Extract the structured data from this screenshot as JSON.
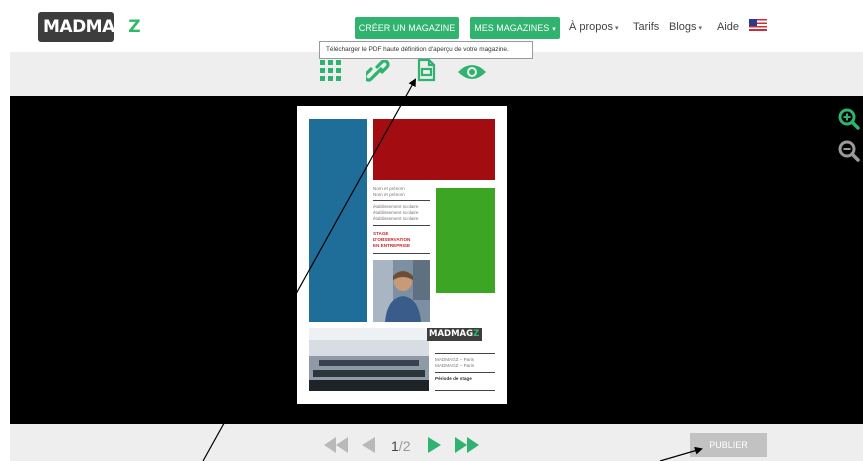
{
  "header": {
    "logo": {
      "main": "MADMAG",
      "accent": "Z"
    },
    "create_label": "CRÉER UN MAGAZINE",
    "my_mags_label": "MES MAGAZINES",
    "links": [
      {
        "label": "À propos",
        "dropdown": true
      },
      {
        "label": "Tarifs",
        "dropdown": false
      },
      {
        "label": "Blogs",
        "dropdown": true
      },
      {
        "label": "Aide",
        "dropdown": false
      }
    ],
    "language_icon": "us-flag-icon",
    "caret": "▾"
  },
  "toolbar": {
    "tools": [
      "grid-icon",
      "link-icon",
      "pdf-download-icon",
      "preview-eye-icon"
    ],
    "tooltip": "Télécharger le PDF haute définition d'aperçu de votre magazine."
  },
  "zoom": {
    "in_icon": "zoom-in-icon",
    "out_icon": "zoom-out-icon"
  },
  "preview": {
    "names": [
      "Nom et prénom",
      "Nom et prénom"
    ],
    "schools": [
      "établissement scolaire",
      "établissement scolaire",
      "établissement scolaire"
    ],
    "title_lines": [
      "STAGE",
      "D'OBSERVATION",
      "EN ENTREPRISE"
    ],
    "footer_logo": {
      "main": "MADMAG",
      "accent": "Z"
    },
    "footer_lines": [
      "MADMAGZ – Paris",
      "MADMAGZ – Paris"
    ],
    "footer_caption": "Période de stage"
  },
  "pager": {
    "current": "1",
    "separator": "/",
    "total": "2"
  },
  "publish_label": "PUBLIER",
  "colors": {
    "brand_green": "#2fb36e",
    "blue": "#1f6d99",
    "red": "#a30d12",
    "green": "#3ca524"
  }
}
